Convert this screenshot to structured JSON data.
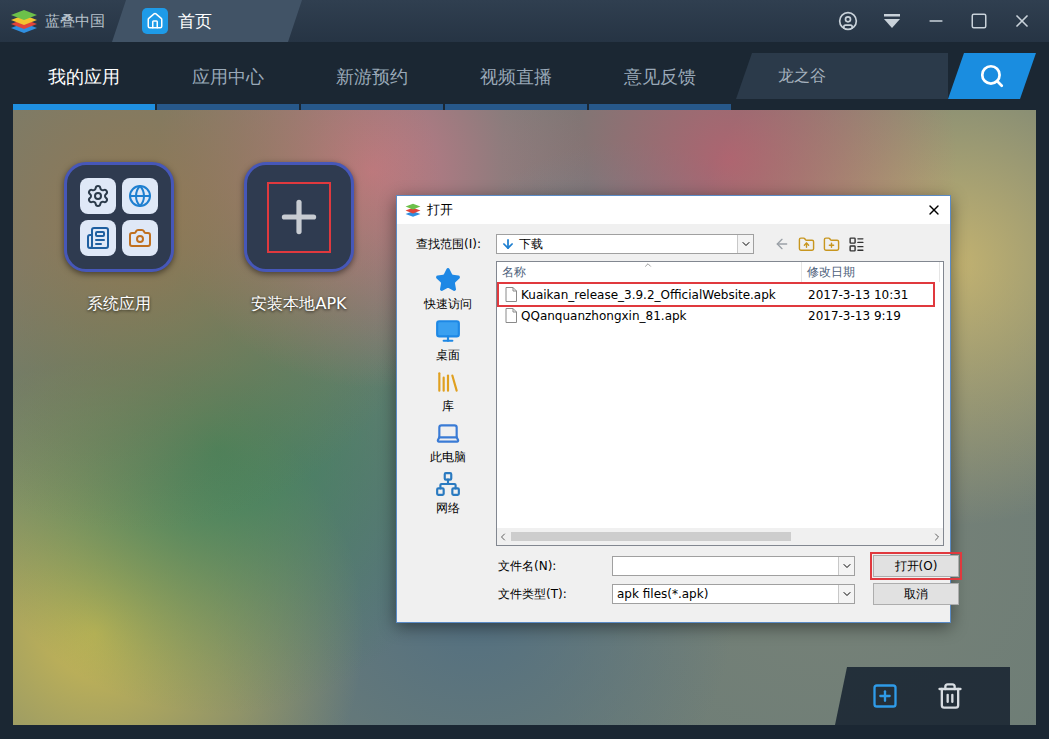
{
  "window": {
    "brand": "蓝叠中国",
    "tabs": [
      {
        "label": "首页",
        "selected": true
      }
    ]
  },
  "nav": {
    "tabs": [
      {
        "label": "我的应用",
        "selected": true
      },
      {
        "label": "应用中心",
        "selected": false
      },
      {
        "label": "新游预约",
        "selected": false
      },
      {
        "label": "视频直播",
        "selected": false
      },
      {
        "label": "意见反馈",
        "selected": false
      }
    ]
  },
  "search": {
    "value": "龙之谷"
  },
  "apps": [
    {
      "label": "系统应用",
      "kind": "system",
      "highlighted": false
    },
    {
      "label": "安装本地APK",
      "kind": "add",
      "highlighted": true
    }
  ],
  "dialog": {
    "title": "打开",
    "lookin_label": "查找范围(I):",
    "lookin_value": "下载",
    "places": [
      {
        "label": "快速访问",
        "kind": "quick"
      },
      {
        "label": "桌面",
        "kind": "desktop"
      },
      {
        "label": "库",
        "kind": "library"
      },
      {
        "label": "此电脑",
        "kind": "computer"
      },
      {
        "label": "网络",
        "kind": "network"
      }
    ],
    "columns": [
      "名称",
      "修改日期"
    ],
    "files": [
      {
        "name": "Kuaikan_release_3.9.2_OfficialWebsite.apk",
        "modified": "2017-3-13 10:31",
        "selected": false,
        "highlighted": true
      },
      {
        "name": "QQanquanzhongxin_81.apk",
        "modified": "2017-3-13 9:19",
        "selected": false,
        "highlighted": false
      }
    ],
    "filename_label": "文件名(N):",
    "filename_value": "",
    "filetype_label": "文件类型(T):",
    "filetype_value": "apk files(*.apk)",
    "buttons": [
      {
        "label": "打开(O)",
        "highlighted": true
      },
      {
        "label": "取消",
        "highlighted": false
      }
    ]
  }
}
